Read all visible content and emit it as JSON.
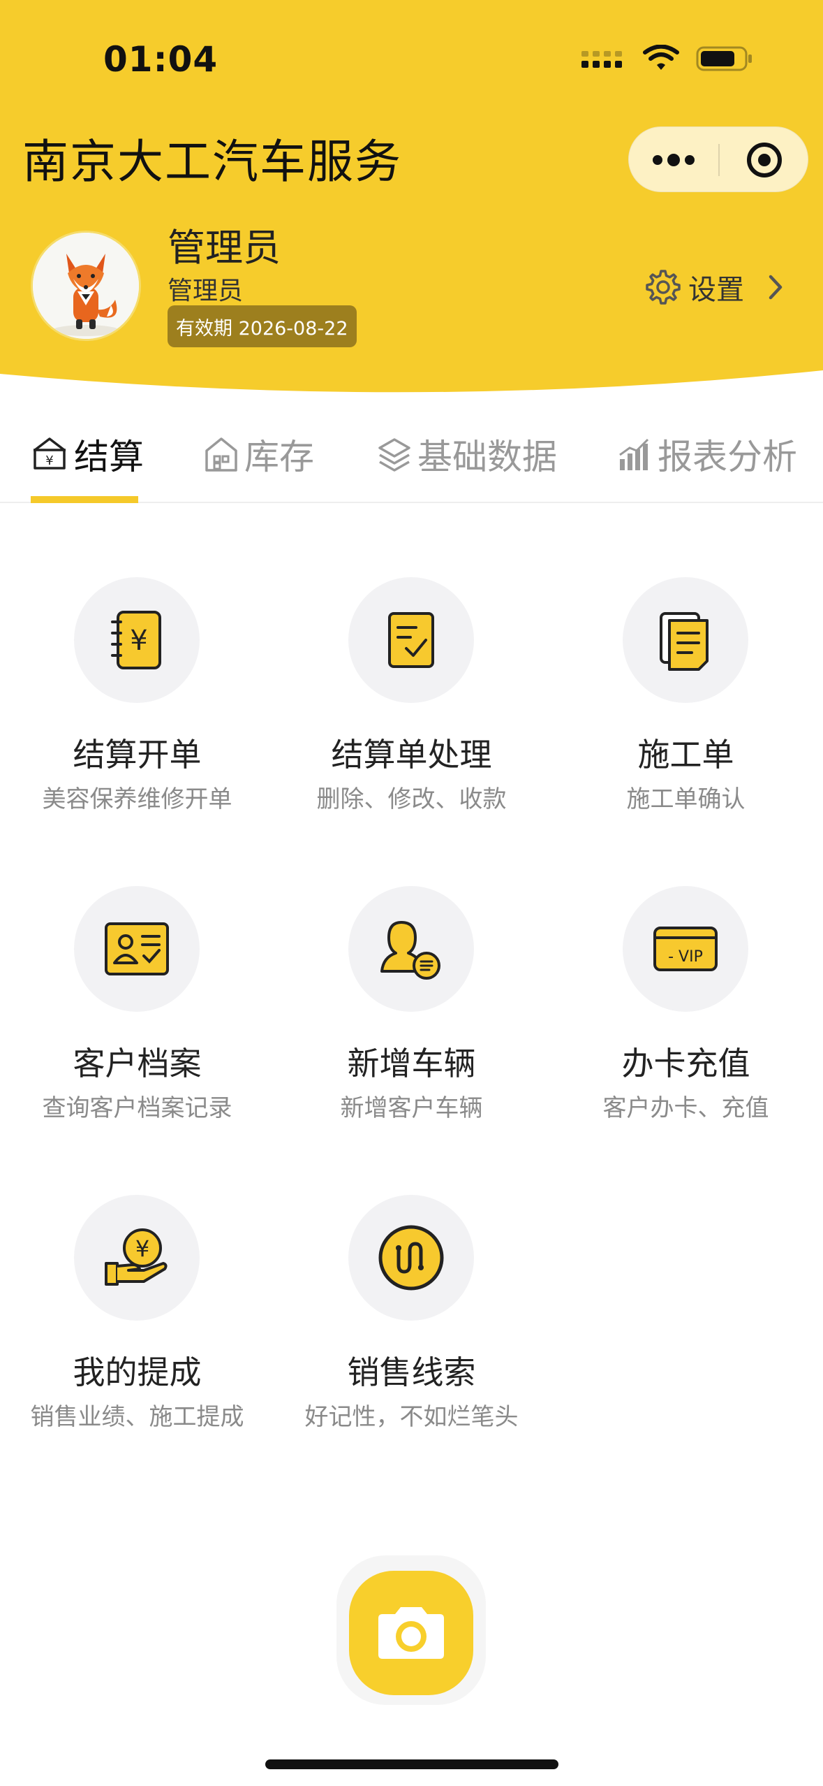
{
  "status_bar": {
    "time": "01:04"
  },
  "header": {
    "app_title": "南京大工汽车服务",
    "brand_color": "#F6CC2C"
  },
  "capsule": {
    "more_icon": "more-dots-icon",
    "close_icon": "target-icon"
  },
  "user": {
    "name": "管理员",
    "role": "管理员",
    "validity": "有效期 2026-08-22",
    "avatar": "fox-avatar"
  },
  "settings": {
    "label": "设置"
  },
  "tabs": [
    {
      "label": "结算",
      "icon": "cashier-icon",
      "active": true
    },
    {
      "label": "库存",
      "icon": "warehouse-icon",
      "active": false
    },
    {
      "label": "基础数据",
      "icon": "layers-icon",
      "active": false
    },
    {
      "label": "报表分析",
      "icon": "bar-chart-icon",
      "active": false
    }
  ],
  "menu": [
    {
      "title": "结算开单",
      "subtitle": "美容保养维修开单",
      "icon": "yen-notebook-icon"
    },
    {
      "title": "结算单处理",
      "subtitle": "删除、修改、收款",
      "icon": "checklist-icon"
    },
    {
      "title": "施工单",
      "subtitle": "施工单确认",
      "icon": "documents-icon"
    },
    {
      "title": "客户档案",
      "subtitle": "查询客户档案记录",
      "icon": "id-card-icon"
    },
    {
      "title": "新增车辆",
      "subtitle": "新增客户车辆",
      "icon": "user-add-icon"
    },
    {
      "title": "办卡充值",
      "subtitle": "客户办卡、充值",
      "icon": "vip-card-icon"
    },
    {
      "title": "我的提成",
      "subtitle": "销售业绩、施工提成",
      "icon": "hand-coin-icon"
    },
    {
      "title": "销售线索",
      "subtitle": "好记性，不如烂笔头",
      "icon": "route-icon"
    }
  ],
  "fab": {
    "icon": "camera-icon"
  }
}
